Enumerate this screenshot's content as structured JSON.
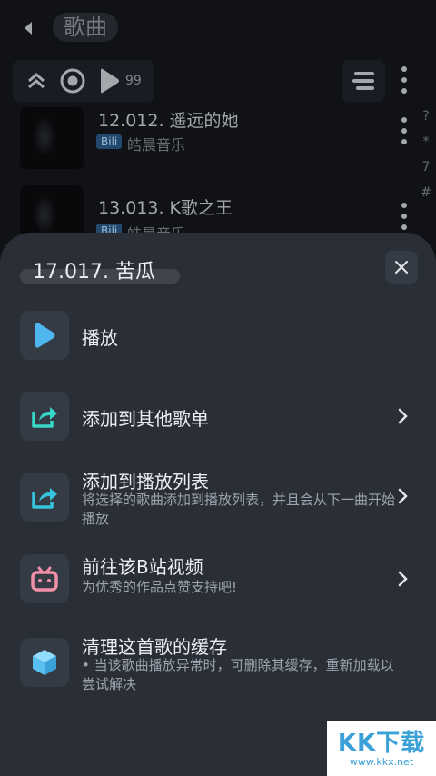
{
  "header": {
    "title": "歌曲"
  },
  "toolbar": {
    "count": "99"
  },
  "songs": [
    {
      "title": "12.012. 遥远的她",
      "badge": "Bili",
      "artist": "皓晨音乐"
    },
    {
      "title": "13.013. K歌之王",
      "badge": "Bili",
      "artist": "皓晨音乐"
    }
  ],
  "index_bar": [
    "?",
    "*",
    "7",
    "#"
  ],
  "sheet": {
    "title": "17.017. 苦瓜",
    "actions": [
      {
        "label": "播放",
        "desc": ""
      },
      {
        "label": "添加到其他歌单",
        "desc": ""
      },
      {
        "label": "添加到播放列表",
        "desc": "将选择的歌曲添加到播放列表，并且会从下一曲开始播放"
      },
      {
        "label": "前往该B站视频",
        "desc": "为优秀的作品点赞支持吧!"
      },
      {
        "label": "清理这首歌的缓存",
        "desc": "• 当该歌曲播放异常时，可删除其缓存，重新加载以尝试解决"
      }
    ]
  },
  "watermark": {
    "logo": "KK下载",
    "url": "www.kkx.net"
  },
  "colors": {
    "sheet_bg": "#2a2f37",
    "icon_box": "#353b44",
    "play_blue": "#4fb6ef",
    "share_teal": "#36d8c8",
    "bili_pink": "#f08fa6",
    "cube_blue": "#58c0f0"
  },
  "icons": {
    "back": "back-arrow-icon",
    "collapse": "double-chevron-up-icon",
    "record": "record-icon",
    "play": "play-icon",
    "menu": "menu-lines-icon",
    "more": "more-vertical-icon",
    "close": "close-icon",
    "share": "share-icon",
    "bilibili": "bilibili-tv-icon",
    "cube": "cube-icon",
    "chevron": "chevron-right-icon"
  }
}
